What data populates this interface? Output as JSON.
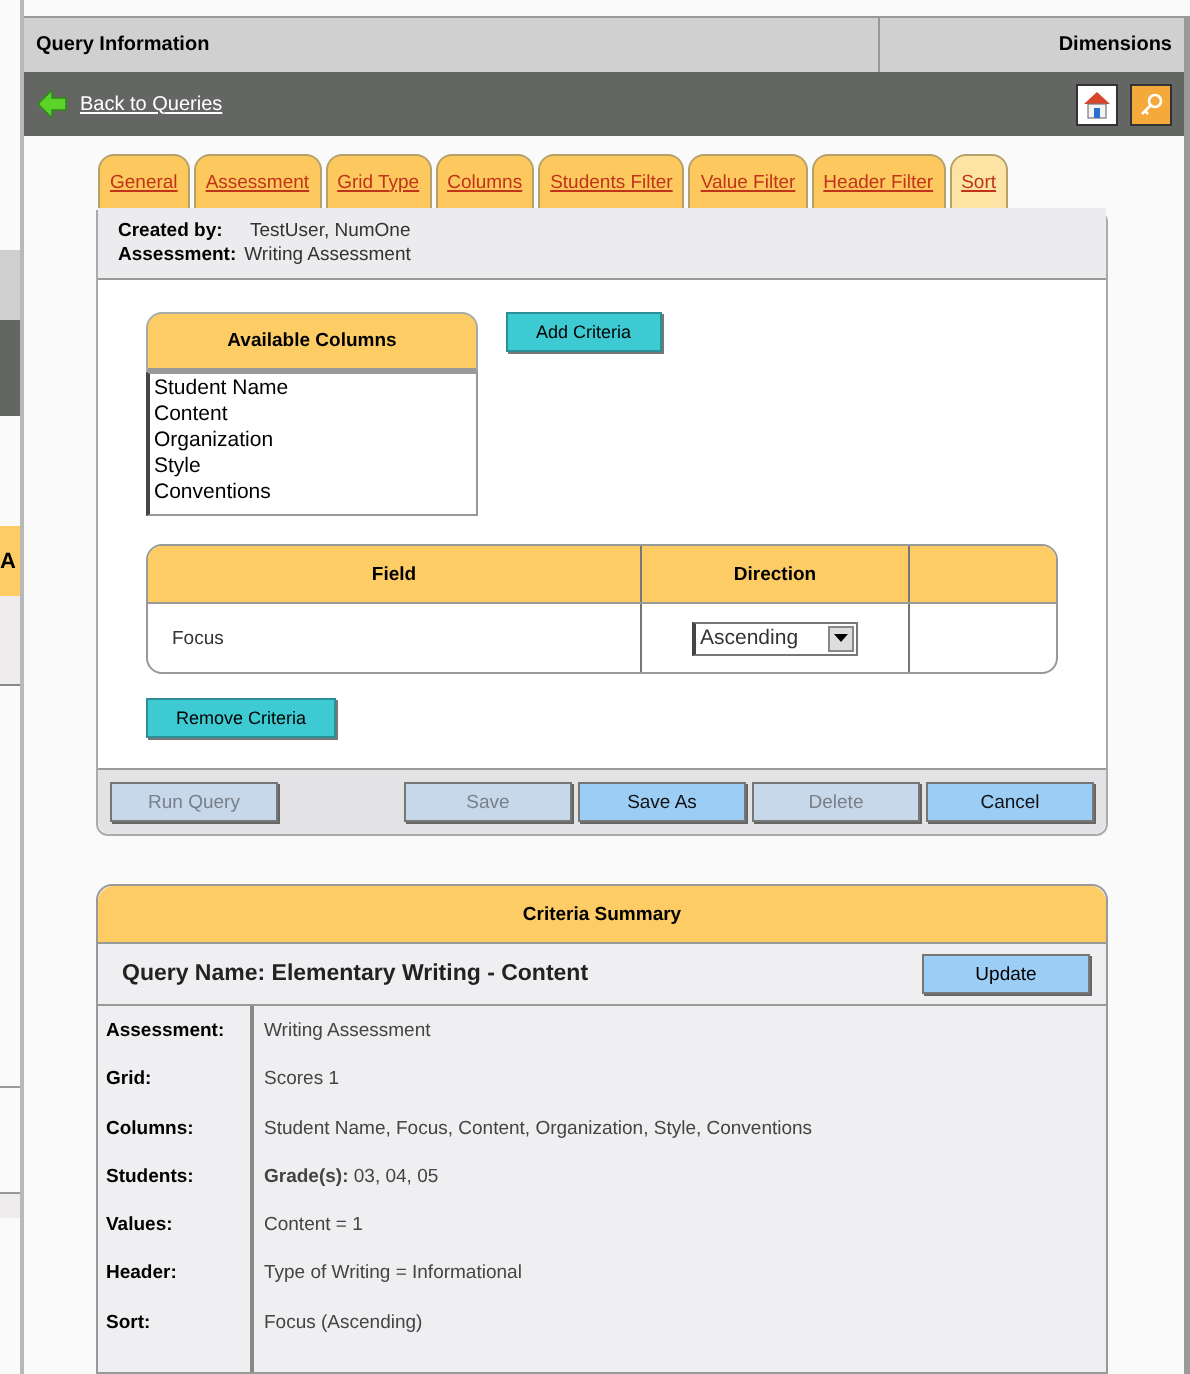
{
  "background_window": {
    "column_header": "A"
  },
  "header": {
    "title": "Query Information",
    "right_title": "Dimensions"
  },
  "toolbar": {
    "back_link": "Back to Queries"
  },
  "tabs": [
    {
      "label": "General",
      "selected": false
    },
    {
      "label": "Assessment",
      "selected": false
    },
    {
      "label": "Grid Type",
      "selected": false
    },
    {
      "label": "Columns",
      "selected": false
    },
    {
      "label": "Students Filter",
      "selected": false
    },
    {
      "label": "Value Filter",
      "selected": false
    },
    {
      "label": "Header Filter",
      "selected": false
    },
    {
      "label": "Sort",
      "selected": true
    }
  ],
  "info": [
    {
      "label": "Created by:",
      "value": "TestUser, NumOne"
    },
    {
      "label": "Assessment:",
      "value": "Writing Assessment"
    }
  ],
  "available_columns": {
    "title": "Available Columns",
    "items": [
      "Student Name",
      "Content",
      "Organization",
      "Style",
      "Conventions"
    ]
  },
  "add_button": "Add Criteria",
  "criteria_table": {
    "columns": [
      "Field",
      "Direction"
    ],
    "rows": [
      {
        "field": "Focus",
        "direction": "Ascending"
      }
    ]
  },
  "remove_button": "Remove Criteria",
  "left_actions": [
    {
      "label": "Run Query",
      "disabled": true
    }
  ],
  "right_actions": [
    {
      "label": "Save",
      "disabled": true
    },
    {
      "label": "Save As",
      "disabled": false
    },
    {
      "label": "Delete",
      "disabled": true
    },
    {
      "label": "Cancel",
      "disabled": false
    }
  ],
  "summary": {
    "title": "Criteria Summary",
    "query_name": "Query Name: Elementary Writing - Content",
    "update_button": "Update",
    "rows": [
      {
        "label": "Assessment:",
        "value": "Writing Assessment"
      },
      {
        "label": "Grid:",
        "value": "Scores 1"
      },
      {
        "label": "Columns:",
        "value": "Student Name, Focus, Content, Organization, Style, Conventions"
      },
      {
        "label": "Students:",
        "value": "**Grade(s):** 03, 04, 05"
      },
      {
        "label": "Values:",
        "value": "Content = 1"
      },
      {
        "label": "Header:",
        "value": "Type of Writing = Informational"
      },
      {
        "label": "Sort:",
        "value": "Focus (Ascending)"
      }
    ]
  }
}
